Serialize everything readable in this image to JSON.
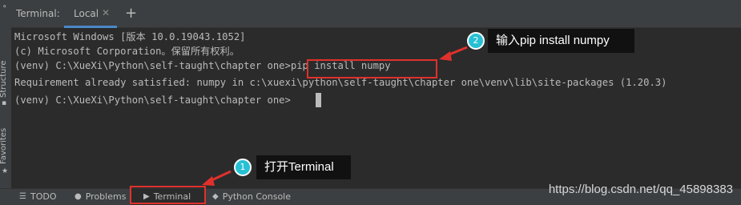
{
  "sidebar": {
    "structure_label": "Structure",
    "favorites_label": "Favorites"
  },
  "tabbar": {
    "title": "Terminal:",
    "tab_local": "Local",
    "close_glyph": "✕",
    "add_glyph": "+"
  },
  "terminal": {
    "lines": [
      "Microsoft Windows [版本 10.0.19043.1052]",
      "(c) Microsoft Corporation。保留所有权利。",
      "(venv) C:\\XueXi\\Python\\self-taught\\chapter one>pip install numpy",
      "Requirement already satisfied: numpy in c:\\xuexi\\python\\self-taught\\chapter one\\venv\\lib\\site-packages (1.20.3)",
      "(venv) C:\\XueXi\\Python\\self-taught\\chapter one>"
    ]
  },
  "annotations": {
    "step1_number": "1",
    "step1_text": "打开Terminal",
    "step2_number": "2",
    "step2_text": "输入pip install numpy",
    "highlight_color": "#e0312c",
    "badge_color": "#27c0d4"
  },
  "bottombar": {
    "todo": "TODO",
    "problems": "Problems",
    "terminal": "Terminal",
    "python_console": "Python Console"
  },
  "watermark": "https://blog.csdn.net/qq_45898383"
}
